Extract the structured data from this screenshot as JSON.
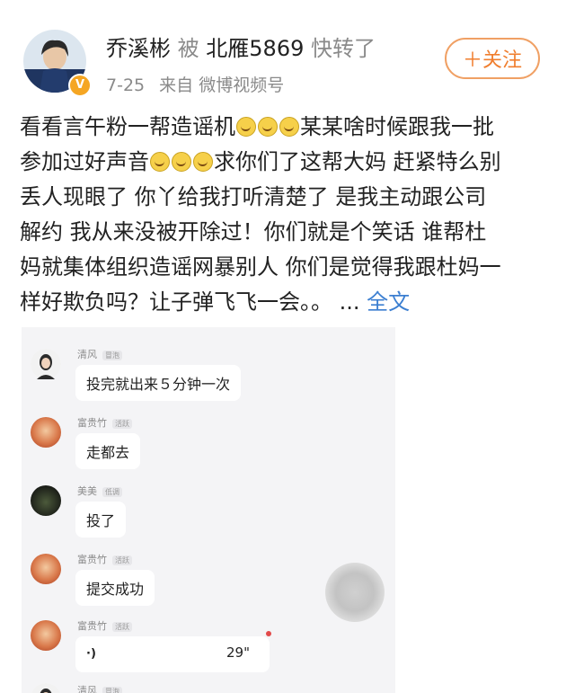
{
  "post": {
    "author": "乔溪彬",
    "by_word": "被",
    "reposter": "北雁5869",
    "repost_action": "快转了",
    "date": "7-25",
    "source_prefix": "来自",
    "source": "微博视频号",
    "follow_label": "＋关注",
    "verified_badge": "V",
    "text_lines": [
      "看看言午粉一帮造谣机",
      "某某啥时候跟我一批",
      "参加过好声音",
      "求你们了这帮大妈 赶紧特么别",
      "丢人现眼了 你丫给我打听清楚了 是我主动跟公司",
      "解约 我从来没被开除过！你们就是个笑话 谁帮杜",
      "妈就集体组织造谣网暴别人 你们是觉得我跟杜妈一",
      "样好欺负吗？让子弹飞飞一会。。 ..."
    ],
    "full_text_link": "全文"
  },
  "chat": {
    "messages": [
      {
        "name": "清风",
        "tag": "冒泡",
        "text": "投完就出来５分钟一次"
      },
      {
        "name": "富贵竹",
        "tag": "活跃",
        "text": "走都去"
      },
      {
        "name": "美美",
        "tag": "低调",
        "text": "投了"
      },
      {
        "name": "富贵竹",
        "tag": "活跃",
        "text": "提交成功"
      },
      {
        "name": "富贵竹",
        "tag": "活跃",
        "voice_icon": "·)",
        "duration": "29\""
      },
      {
        "name": "清风",
        "tag": "冒泡"
      }
    ]
  },
  "icons": {
    "emoji": "laughing-crying-emoji",
    "voice": "voice-wave-icon",
    "record": "record-button"
  },
  "colors": {
    "follow_orange": "#f07e2e",
    "link_blue": "#3c7fd1",
    "meta_gray": "#8a8a8a",
    "verified": "#f5a623"
  }
}
